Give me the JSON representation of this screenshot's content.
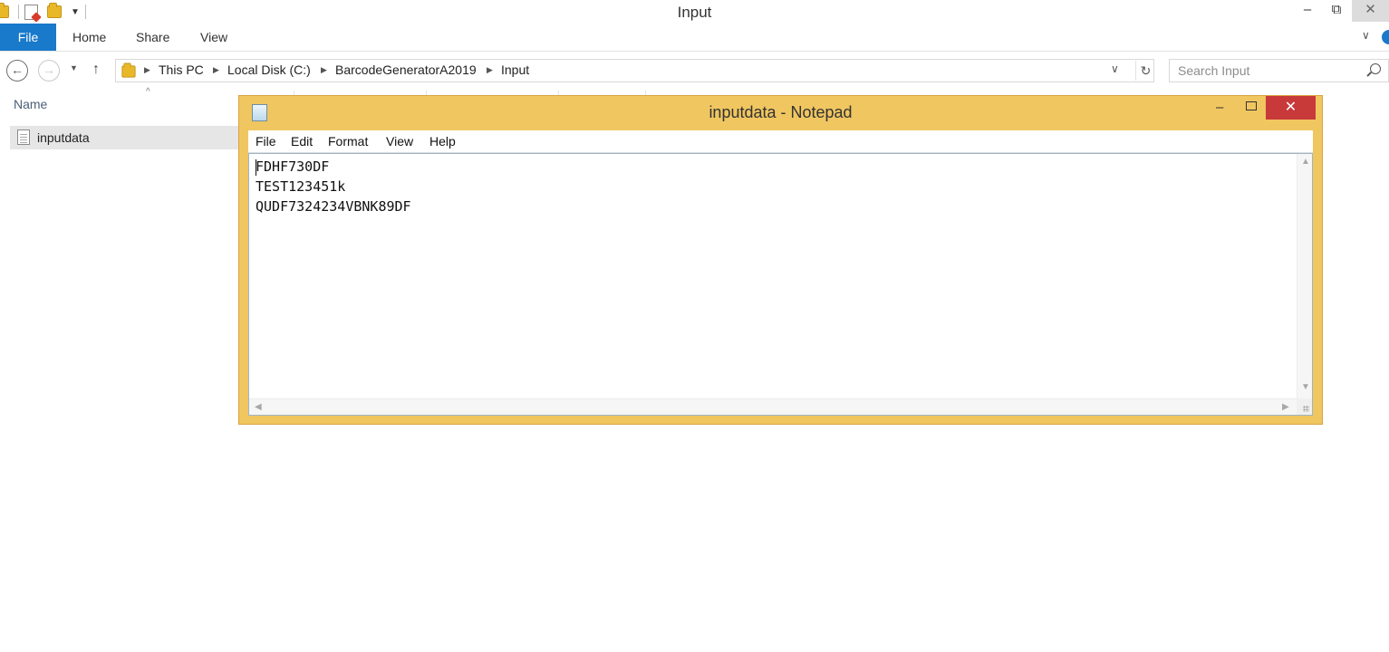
{
  "explorer": {
    "title": "Input",
    "controls": {
      "minimize": "–",
      "maximize": "⧉",
      "close": "✕"
    },
    "tabs": [
      "File",
      "Home",
      "Share",
      "View"
    ],
    "breadcrumb": [
      "This PC",
      "Local Disk (C:)",
      "BarcodeGeneratorA2019",
      "Input"
    ],
    "search_placeholder": "Search Input",
    "column_name": "Name",
    "files": [
      {
        "name": "inputdata",
        "icon": "text-file-icon"
      }
    ]
  },
  "notepad": {
    "title": "inputdata - Notepad",
    "controls": {
      "minimize": "–",
      "close": "✕"
    },
    "menu": [
      "File",
      "Edit",
      "Format",
      "View",
      "Help"
    ],
    "lines": [
      "FDHF730DF",
      "TEST123451k",
      "QUDF7324234VBNK89DF"
    ]
  },
  "colors": {
    "ribbon_file": "#1979ca",
    "notepad_frame": "#f0c660",
    "notepad_close": "#c8393a",
    "selected_row": "#e6e6e6"
  }
}
